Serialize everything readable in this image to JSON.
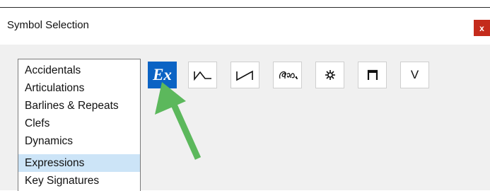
{
  "dialog": {
    "title": "Symbol Selection",
    "close_label": "x"
  },
  "categories": [
    {
      "label": "Accidentals"
    },
    {
      "label": "Articulations"
    },
    {
      "label": "Barlines & Repeats"
    },
    {
      "label": "Clefs"
    },
    {
      "label": "Dynamics"
    },
    {
      "label": "Expressions",
      "selected": true
    },
    {
      "label": "Key Signatures"
    }
  ],
  "toolbar": {
    "buttons": [
      {
        "icon": "expression-icon",
        "label": "Ex",
        "active": true
      },
      {
        "icon": "line-down-icon"
      },
      {
        "icon": "line-up-icon"
      },
      {
        "icon": "pedal-icon"
      },
      {
        "icon": "pedal-release-icon"
      },
      {
        "icon": "bracket-icon"
      },
      {
        "icon": "v-icon",
        "label": "V"
      }
    ]
  },
  "annotation": {
    "icon": "pointer-arrow",
    "color": "#5cb85c"
  },
  "colors": {
    "accent": "#0b63c4",
    "close": "#c42b1c",
    "selection": "#cce4f7"
  }
}
